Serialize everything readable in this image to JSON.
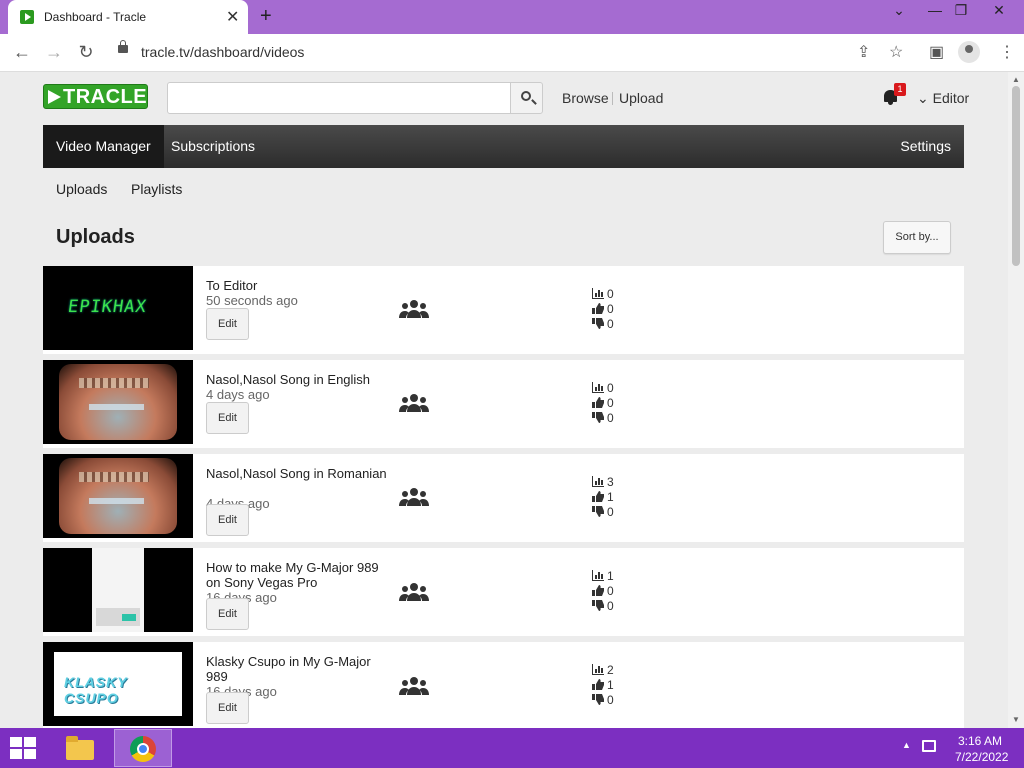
{
  "browser": {
    "tab_title": "Dashboard - Tracle",
    "url": "tracle.tv/dashboard/videos",
    "new_tab_label": "+",
    "tab_close_label": "✕"
  },
  "site": {
    "logo_text": "TRACLE",
    "brand_color": "#33a428",
    "search_placeholder": "",
    "links": {
      "browse": "Browse",
      "upload": "Upload"
    },
    "notification_count": "1",
    "user_menu": "Editor"
  },
  "navbar": {
    "items": [
      "Video Manager",
      "Subscriptions"
    ],
    "right_item": "Settings"
  },
  "subnav": [
    "Uploads",
    "Playlists"
  ],
  "page": {
    "title": "Uploads",
    "sort_label": "Sort by..."
  },
  "videos": [
    {
      "title": "To Editor",
      "age": "50 seconds ago",
      "edit": "Edit",
      "views": "0",
      "likes": "0",
      "dislikes": "0",
      "thumb": "epikhax",
      "thumb_text": "EPIKHAX"
    },
    {
      "title": "Nasol,Nasol Song in English",
      "age": "4 days ago",
      "edit": "Edit",
      "views": "0",
      "likes": "0",
      "dislikes": "0",
      "thumb": "room"
    },
    {
      "title": "Nasol,Nasol Song in Romanian",
      "age": "4 days ago",
      "edit": "Edit",
      "views": "3",
      "likes": "1",
      "dislikes": "0",
      "thumb": "room"
    },
    {
      "title": "How to make My G-Major 989 on Sony Vegas Pro",
      "age": "16 days ago",
      "edit": "Edit",
      "views": "1",
      "likes": "0",
      "dislikes": "0",
      "thumb": "screen"
    },
    {
      "title": "Klasky Csupo in My G-Major 989",
      "age": "16 days ago",
      "edit": "Edit",
      "views": "2",
      "likes": "1",
      "dislikes": "0",
      "thumb": "klasky",
      "thumb_text": "KLASKY CSUPO"
    }
  ],
  "taskbar": {
    "time": "3:16 AM",
    "date": "7/22/2022"
  }
}
